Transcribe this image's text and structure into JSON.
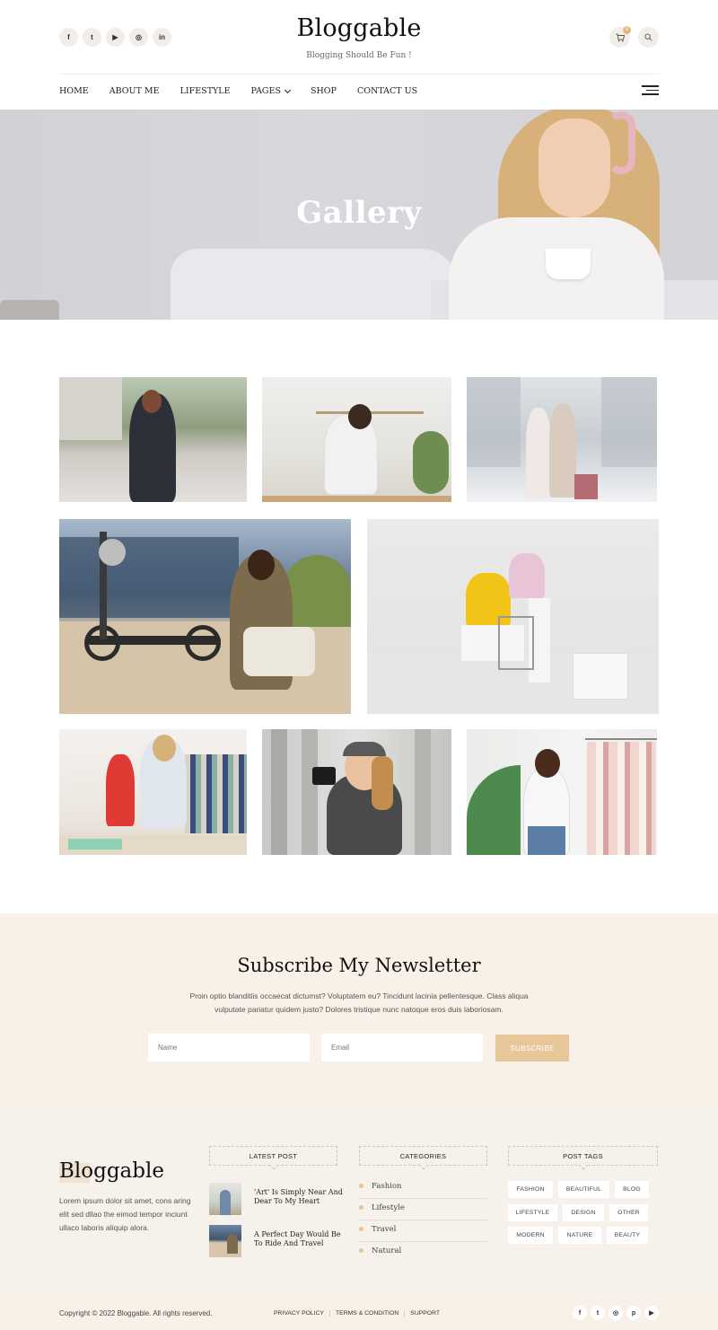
{
  "header": {
    "socials": [
      {
        "icon": "facebook-icon",
        "glyph": "f"
      },
      {
        "icon": "twitter-icon",
        "glyph": "t"
      },
      {
        "icon": "youtube-icon",
        "glyph": "▶"
      },
      {
        "icon": "instagram-icon",
        "glyph": "◎"
      },
      {
        "icon": "linkedin-icon",
        "glyph": "in"
      }
    ],
    "logo": "Bloggable",
    "tagline": "Blogging Should Be Fun !",
    "cart_count": "0",
    "cart_icon": "cart-icon",
    "search_icon": "search-icon"
  },
  "nav": {
    "home": "HOME",
    "about": "ABOUT ME",
    "lifestyle": "LIFESTYLE",
    "pages": "PAGES",
    "shop": "SHOP",
    "contact": "CONTACT US"
  },
  "hero": {
    "title": "Gallery"
  },
  "newsletter": {
    "title": "Subscribe My Newsletter",
    "text": "Proin optio blanditiis occaecat dictumst? Voluptatem eu? Tincidunt lacinia pellentesque. Class aliqua vulputate pariatur quidem justo? Dolores tristique nunc natoque eros duis laboriosam.",
    "name_placeholder": "Name",
    "email_placeholder": "Email",
    "button": "SUBSCRIBE"
  },
  "footer": {
    "logo": "Bloggable",
    "description": "Lorem ipsum dolor sit amet, cons aring elit sed dllao the eimod tempor inciunt ullaco laboris aliquip alora.",
    "latest_post_heading": "LATEST POST",
    "latest_posts": [
      {
        "title": "'Art' Is Simply Near And Dear To My Heart"
      },
      {
        "title": "A Perfect Day Would Be To Ride And Travel"
      }
    ],
    "categories_heading": "CATEGORIES",
    "categories": [
      "Fashion",
      "Lifestyle",
      "Travel",
      "Natural"
    ],
    "tags_heading": "POST TAGS",
    "tags": [
      "FASHION",
      "BEAUTIFUL",
      "BLOG",
      "LIFESTYLE",
      "DESIGN",
      "OTHER",
      "MODERN",
      "NATURE",
      "BEAUTY"
    ]
  },
  "bottom": {
    "copyright": "Copyright © 2022 Bloggable. All rights reserved.",
    "links": [
      "PRIVACY POLICY",
      "TERMS & CONDITION",
      "SUPPORT"
    ],
    "socials": [
      {
        "icon": "facebook-icon",
        "glyph": "f"
      },
      {
        "icon": "twitter-icon",
        "glyph": "t"
      },
      {
        "icon": "instagram-icon",
        "glyph": "◎"
      },
      {
        "icon": "pinterest-icon",
        "glyph": "p"
      },
      {
        "icon": "youtube-icon",
        "glyph": "▶"
      }
    ]
  },
  "colors": {
    "accent": "#e7c79a",
    "cream": "#f9f1e8",
    "footer_bg": "#f6f1ea"
  }
}
